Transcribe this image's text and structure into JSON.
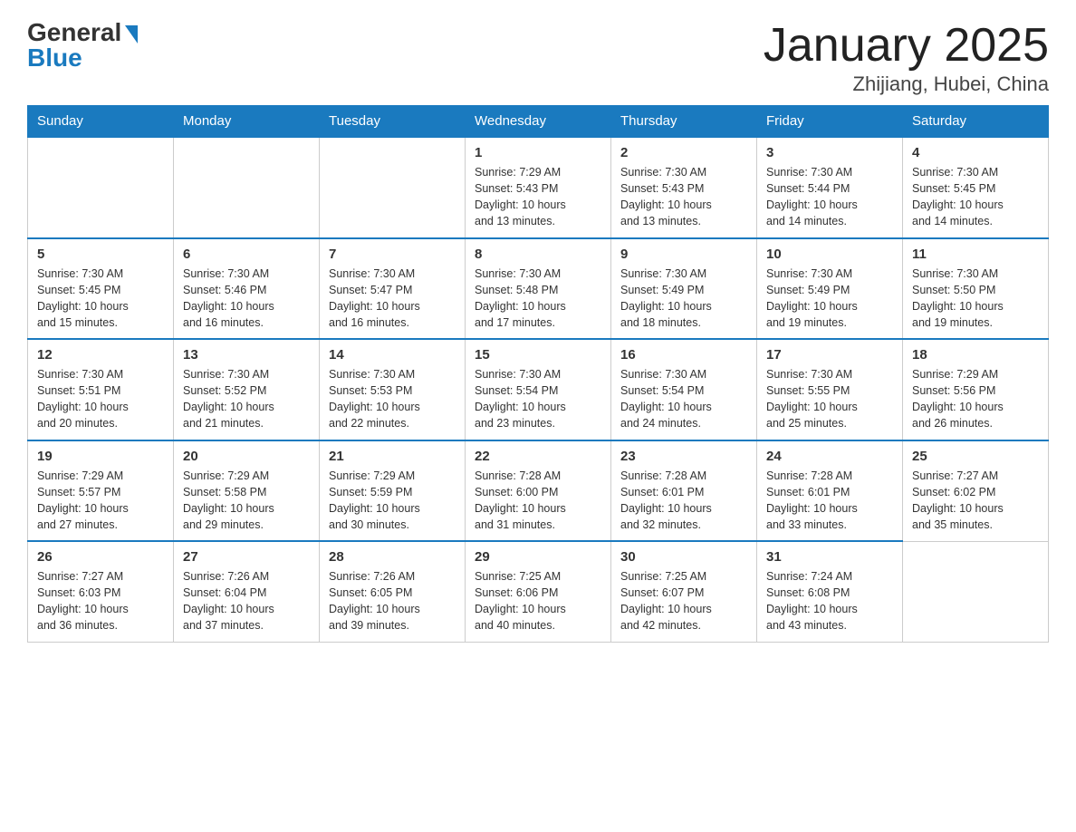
{
  "logo": {
    "general": "General",
    "blue": "Blue"
  },
  "title": "January 2025",
  "subtitle": "Zhijiang, Hubei, China",
  "days_of_week": [
    "Sunday",
    "Monday",
    "Tuesday",
    "Wednesday",
    "Thursday",
    "Friday",
    "Saturday"
  ],
  "weeks": [
    [
      {
        "day": "",
        "info": ""
      },
      {
        "day": "",
        "info": ""
      },
      {
        "day": "",
        "info": ""
      },
      {
        "day": "1",
        "info": "Sunrise: 7:29 AM\nSunset: 5:43 PM\nDaylight: 10 hours\nand 13 minutes."
      },
      {
        "day": "2",
        "info": "Sunrise: 7:30 AM\nSunset: 5:43 PM\nDaylight: 10 hours\nand 13 minutes."
      },
      {
        "day": "3",
        "info": "Sunrise: 7:30 AM\nSunset: 5:44 PM\nDaylight: 10 hours\nand 14 minutes."
      },
      {
        "day": "4",
        "info": "Sunrise: 7:30 AM\nSunset: 5:45 PM\nDaylight: 10 hours\nand 14 minutes."
      }
    ],
    [
      {
        "day": "5",
        "info": "Sunrise: 7:30 AM\nSunset: 5:45 PM\nDaylight: 10 hours\nand 15 minutes."
      },
      {
        "day": "6",
        "info": "Sunrise: 7:30 AM\nSunset: 5:46 PM\nDaylight: 10 hours\nand 16 minutes."
      },
      {
        "day": "7",
        "info": "Sunrise: 7:30 AM\nSunset: 5:47 PM\nDaylight: 10 hours\nand 16 minutes."
      },
      {
        "day": "8",
        "info": "Sunrise: 7:30 AM\nSunset: 5:48 PM\nDaylight: 10 hours\nand 17 minutes."
      },
      {
        "day": "9",
        "info": "Sunrise: 7:30 AM\nSunset: 5:49 PM\nDaylight: 10 hours\nand 18 minutes."
      },
      {
        "day": "10",
        "info": "Sunrise: 7:30 AM\nSunset: 5:49 PM\nDaylight: 10 hours\nand 19 minutes."
      },
      {
        "day": "11",
        "info": "Sunrise: 7:30 AM\nSunset: 5:50 PM\nDaylight: 10 hours\nand 19 minutes."
      }
    ],
    [
      {
        "day": "12",
        "info": "Sunrise: 7:30 AM\nSunset: 5:51 PM\nDaylight: 10 hours\nand 20 minutes."
      },
      {
        "day": "13",
        "info": "Sunrise: 7:30 AM\nSunset: 5:52 PM\nDaylight: 10 hours\nand 21 minutes."
      },
      {
        "day": "14",
        "info": "Sunrise: 7:30 AM\nSunset: 5:53 PM\nDaylight: 10 hours\nand 22 minutes."
      },
      {
        "day": "15",
        "info": "Sunrise: 7:30 AM\nSunset: 5:54 PM\nDaylight: 10 hours\nand 23 minutes."
      },
      {
        "day": "16",
        "info": "Sunrise: 7:30 AM\nSunset: 5:54 PM\nDaylight: 10 hours\nand 24 minutes."
      },
      {
        "day": "17",
        "info": "Sunrise: 7:30 AM\nSunset: 5:55 PM\nDaylight: 10 hours\nand 25 minutes."
      },
      {
        "day": "18",
        "info": "Sunrise: 7:29 AM\nSunset: 5:56 PM\nDaylight: 10 hours\nand 26 minutes."
      }
    ],
    [
      {
        "day": "19",
        "info": "Sunrise: 7:29 AM\nSunset: 5:57 PM\nDaylight: 10 hours\nand 27 minutes."
      },
      {
        "day": "20",
        "info": "Sunrise: 7:29 AM\nSunset: 5:58 PM\nDaylight: 10 hours\nand 29 minutes."
      },
      {
        "day": "21",
        "info": "Sunrise: 7:29 AM\nSunset: 5:59 PM\nDaylight: 10 hours\nand 30 minutes."
      },
      {
        "day": "22",
        "info": "Sunrise: 7:28 AM\nSunset: 6:00 PM\nDaylight: 10 hours\nand 31 minutes."
      },
      {
        "day": "23",
        "info": "Sunrise: 7:28 AM\nSunset: 6:01 PM\nDaylight: 10 hours\nand 32 minutes."
      },
      {
        "day": "24",
        "info": "Sunrise: 7:28 AM\nSunset: 6:01 PM\nDaylight: 10 hours\nand 33 minutes."
      },
      {
        "day": "25",
        "info": "Sunrise: 7:27 AM\nSunset: 6:02 PM\nDaylight: 10 hours\nand 35 minutes."
      }
    ],
    [
      {
        "day": "26",
        "info": "Sunrise: 7:27 AM\nSunset: 6:03 PM\nDaylight: 10 hours\nand 36 minutes."
      },
      {
        "day": "27",
        "info": "Sunrise: 7:26 AM\nSunset: 6:04 PM\nDaylight: 10 hours\nand 37 minutes."
      },
      {
        "day": "28",
        "info": "Sunrise: 7:26 AM\nSunset: 6:05 PM\nDaylight: 10 hours\nand 39 minutes."
      },
      {
        "day": "29",
        "info": "Sunrise: 7:25 AM\nSunset: 6:06 PM\nDaylight: 10 hours\nand 40 minutes."
      },
      {
        "day": "30",
        "info": "Sunrise: 7:25 AM\nSunset: 6:07 PM\nDaylight: 10 hours\nand 42 minutes."
      },
      {
        "day": "31",
        "info": "Sunrise: 7:24 AM\nSunset: 6:08 PM\nDaylight: 10 hours\nand 43 minutes."
      },
      {
        "day": "",
        "info": ""
      }
    ]
  ]
}
